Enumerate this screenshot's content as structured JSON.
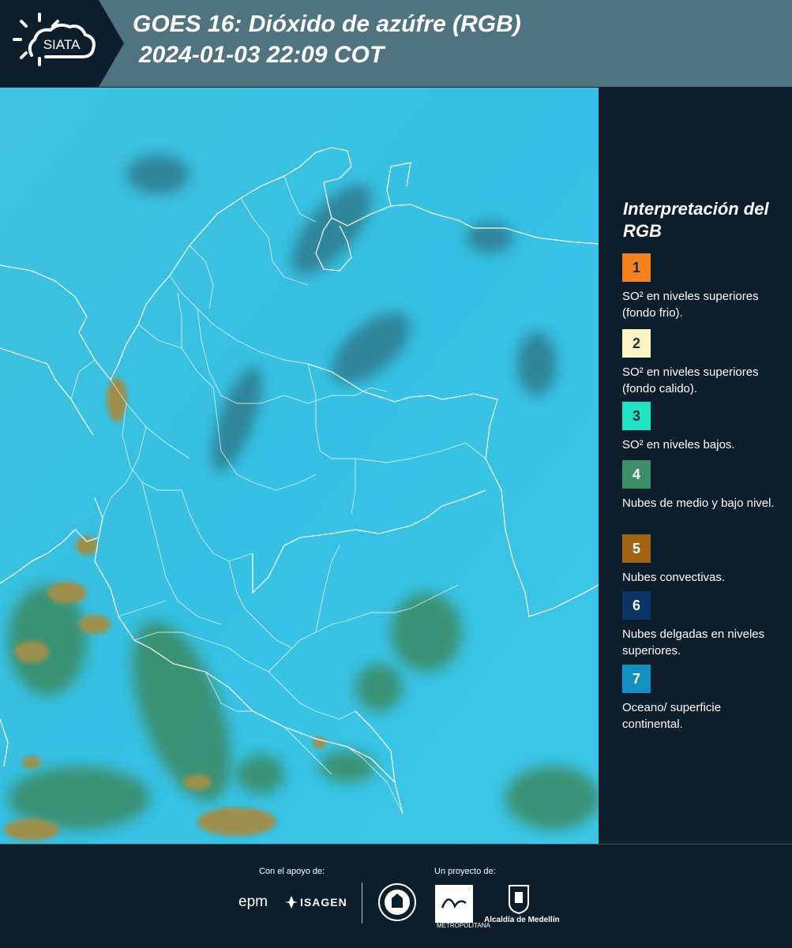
{
  "header": {
    "logo_text": "SIATA",
    "title_line1": "GOES 16: Dióxido de azúfre (RGB)",
    "title_line2": "2024-01-03 22:09 COT"
  },
  "legend": {
    "title": "Interpretación del RGB",
    "items": [
      {
        "number": "1",
        "color": "#f5821f",
        "label": "SO² en niveles superiores (fondo frio)."
      },
      {
        "number": "2",
        "color": "#fff5c4",
        "label": "SO² en niveles superiores (fondo calido)."
      },
      {
        "number": "3",
        "color": "#1fe3c4",
        "label": "SO² en niveles bajos."
      },
      {
        "number": "4",
        "color": "#3a8f67",
        "label": "Nubes de medio y bajo nivel."
      },
      {
        "number": "5",
        "color": "#a16413",
        "label": "Nubes convectivas."
      },
      {
        "number": "6",
        "color": "#0d3466",
        "label": "Nubes delgadas en niveles superiores."
      },
      {
        "number": "7",
        "color": "#1590c2",
        "label": "Oceano/ superficie continental."
      }
    ]
  },
  "footer": {
    "support_label": "Con el apoyo de:",
    "project_label": "Un proyecto de:",
    "sponsors": [
      "epm",
      "ISAGEN"
    ],
    "partners": [
      "METROPOLITANA",
      "Alcaldía de Medellín"
    ]
  },
  "colors": {
    "header_bg": "#50747f",
    "panel_bg": "#0c1e2b",
    "map_base": "#35bfe0"
  }
}
